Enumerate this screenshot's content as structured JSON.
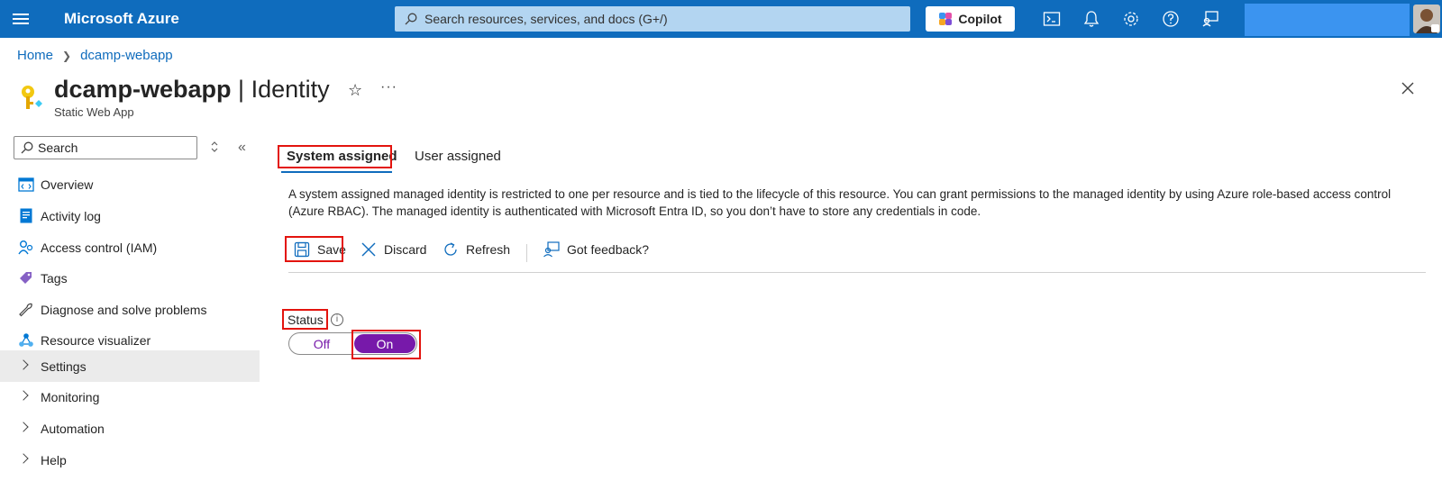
{
  "topbar": {
    "brand": "Microsoft Azure",
    "search_placeholder": "Search resources, services, and docs (G+/)",
    "copilot_label": "Copilot",
    "icons": [
      "cloud-shell-icon",
      "notifications-icon",
      "settings-icon",
      "help-icon",
      "feedback-icon"
    ]
  },
  "breadcrumb": {
    "home": "Home",
    "resource": "dcamp-webapp"
  },
  "header": {
    "resource_name": "dcamp-webapp",
    "separator": " | ",
    "blade": "Identity",
    "subtitle": "Static Web App"
  },
  "nav": {
    "search_placeholder": "Search",
    "items": [
      {
        "label": "Overview",
        "icon": "overview-icon"
      },
      {
        "label": "Activity log",
        "icon": "activity-log-icon"
      },
      {
        "label": "Access control (IAM)",
        "icon": "iam-icon"
      },
      {
        "label": "Tags",
        "icon": "tag-icon"
      },
      {
        "label": "Diagnose and solve problems",
        "icon": "wrench-icon"
      },
      {
        "label": "Resource visualizer",
        "icon": "resource-visualizer-icon"
      },
      {
        "label": "Settings",
        "icon": "chevron-right-icon"
      },
      {
        "label": "Monitoring",
        "icon": "chevron-right-icon"
      },
      {
        "label": "Automation",
        "icon": "chevron-right-icon"
      },
      {
        "label": "Help",
        "icon": "chevron-right-icon"
      }
    ]
  },
  "tabs": [
    {
      "label": "System assigned"
    },
    {
      "label": "User assigned"
    }
  ],
  "description": "A system assigned managed identity is restricted to one per resource and is tied to the lifecycle of this resource. You can grant permissions to the managed identity by using Azure role-based access control (Azure RBAC). The managed identity is authenticated with Microsoft Entra ID, so you don’t have to store any credentials in code.",
  "toolbar": {
    "save": "Save",
    "discard": "Discard",
    "refresh": "Refresh",
    "feedback": "Got feedback?"
  },
  "status": {
    "label": "Status",
    "off": "Off",
    "on": "On",
    "value": "On"
  },
  "colors": {
    "topbar": "#0f6cbd",
    "accent": "#7719aa",
    "highlight": "#e3140e"
  }
}
